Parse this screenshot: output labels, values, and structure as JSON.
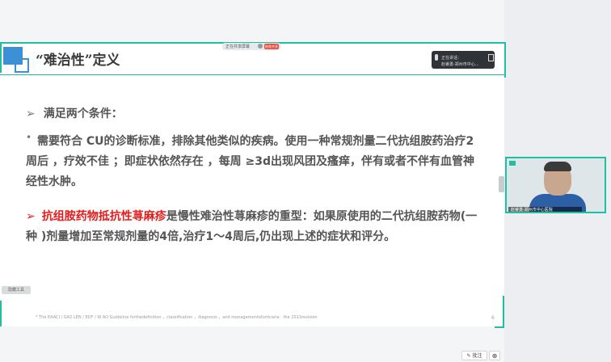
{
  "slide": {
    "title": "“难治性”定义",
    "heading": "满足两个条件：",
    "heading_marker": "➢",
    "bullet_marker": "•",
    "para1": "    需要符合 CU的诊断标准，排除其他类似的疾病。使用一种常规剂量二代抗组胺药治疗2周后 ，疗效不佳 ；即症状依然存在 ，每周 ≥3d出现风团及瘙痒，伴有或者不伴有血管神经性水肿。",
    "para2_marker": "➢",
    "para2_red": "抗组胺药物抵抗性荨麻疹",
    "para2_rest": "是慢性难治性荨麻疹的重型：如果原使用的二代抗组胺药物(一种 )剂量增加至常规剂量的4倍,治疗1～4周后,仍出现上述的症状和评分。",
    "footnote": "*  The EAACI / GA2 LEN / EDF / W AO Guideline forthedefinition ，classification ，diagnosis ，and managementofurticaria：the 2013revision",
    "page_number": "6"
  },
  "meeting_bar": {
    "text": "正在共享屏幕",
    "stop_label": "结束共享"
  },
  "float_toolbar": {
    "line1": "正在讲话：",
    "line2": "赵睿勇-郑州市中心..."
  },
  "left_tab": {
    "label": "隐藏工具"
  },
  "video": {
    "name_label": "赵睿勇-郑州市中心医院"
  },
  "bottom_tools": {
    "annotate_label": "批注",
    "zoom_icon": "⊕"
  },
  "colors": {
    "accent": "#1fbf9f",
    "red": "#e31b1b",
    "logo_blue": "#3d8fd6"
  }
}
